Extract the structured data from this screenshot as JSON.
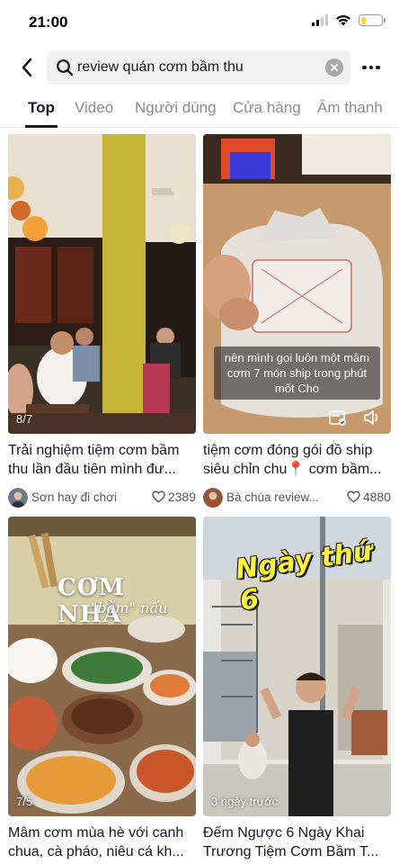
{
  "status_bar": {
    "time": "21:00"
  },
  "search": {
    "query": "review quán cơm bầm thu"
  },
  "tabs": [
    {
      "label": "Top",
      "active": true
    },
    {
      "label": "Video",
      "active": false
    },
    {
      "label": "Người dùng",
      "active": false
    },
    {
      "label": "Cửa hàng",
      "active": false
    },
    {
      "label": "Âm thanh",
      "active": false
    }
  ],
  "results": [
    {
      "badge": "8/7",
      "title": "Trải nghiệm tiệm cơm bầm thu lần đầu tiên mình đư...",
      "author": "Sơn hay đi chơi",
      "likes": "2389"
    },
    {
      "caption": "nên mình gọi luôn một mâm cơm 7 món ship trong phút mốt Cho",
      "title": "tiệm cơm đóng gói đồ ship siêu chỉn chu📍 cơm bầm...",
      "author": "Bà chúa review...",
      "likes": "4880"
    },
    {
      "badge": "7/5",
      "overlay_title": "CƠM NHÀ",
      "overlay_subtitle": "\"bầm\" nấu",
      "title": "Mâm cơm mùa hè với canh chua, cà pháo, niêu cá kh...",
      "author": "",
      "likes": ""
    },
    {
      "badge": "3 ngày trước",
      "overlay_title": "Ngày thứ 6",
      "title": "Đếm Ngược 6 Ngày Khai Trương Tiệm Cơm Bầm T...",
      "author": "",
      "likes": ""
    }
  ],
  "colors": {
    "accent_text": "#161823",
    "secondary_text": "#8a8b91",
    "search_bg": "#f1f1f2",
    "battery": "#f7d84a"
  }
}
